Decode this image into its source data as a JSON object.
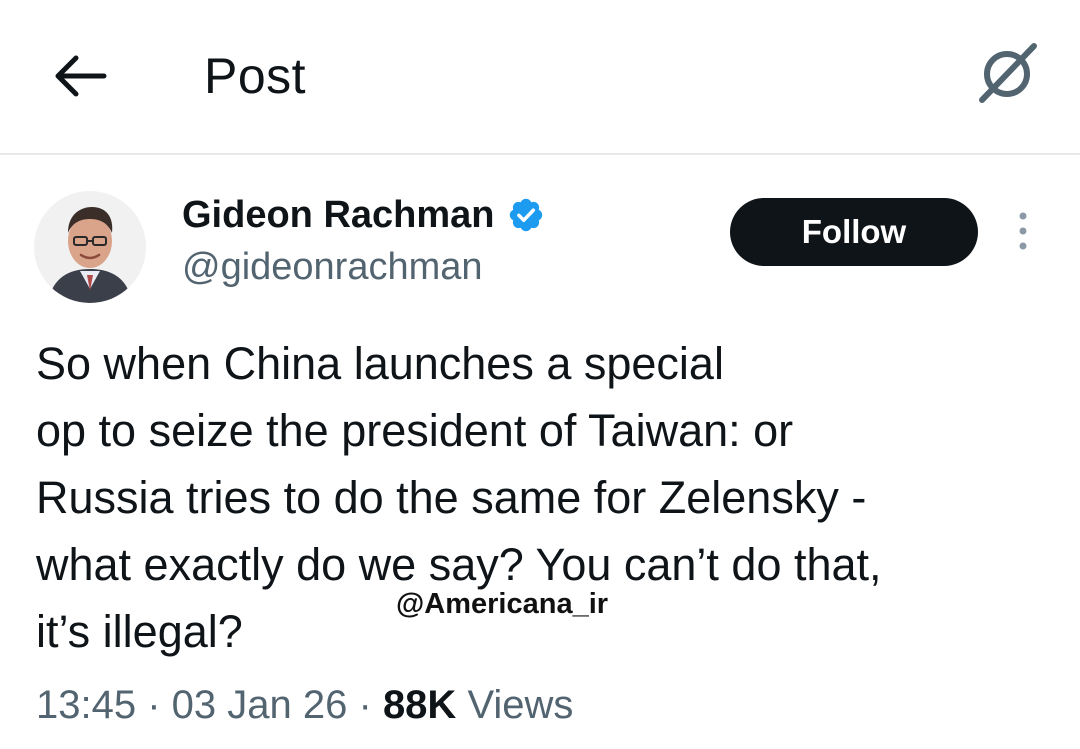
{
  "header": {
    "back_icon": "arrow-left-icon",
    "title": "Post",
    "grok_icon": "grok-icon"
  },
  "post": {
    "author": {
      "display_name": "Gideon Rachman",
      "handle": "@gideonrachman",
      "verified": true,
      "verified_color": "#1d9bf0"
    },
    "follow_label": "Follow",
    "more_icon": "more-vertical-icon",
    "text": "So when China launches a special\nop to seize the president of Taiwan: or\nRussia tries to do the same for Zelensky -\nwhat exactly do we say? You can’t do that,\nit’s illegal?",
    "watermark": "@Americana_ir",
    "meta": {
      "time": "13:45",
      "date": "03 Jan 26",
      "views_count": "88K",
      "views_label": "Views"
    }
  },
  "colors": {
    "text_primary": "#0f1419",
    "text_secondary": "#536471",
    "follow_bg": "#0f1419",
    "divider": "#e6e8ea"
  }
}
